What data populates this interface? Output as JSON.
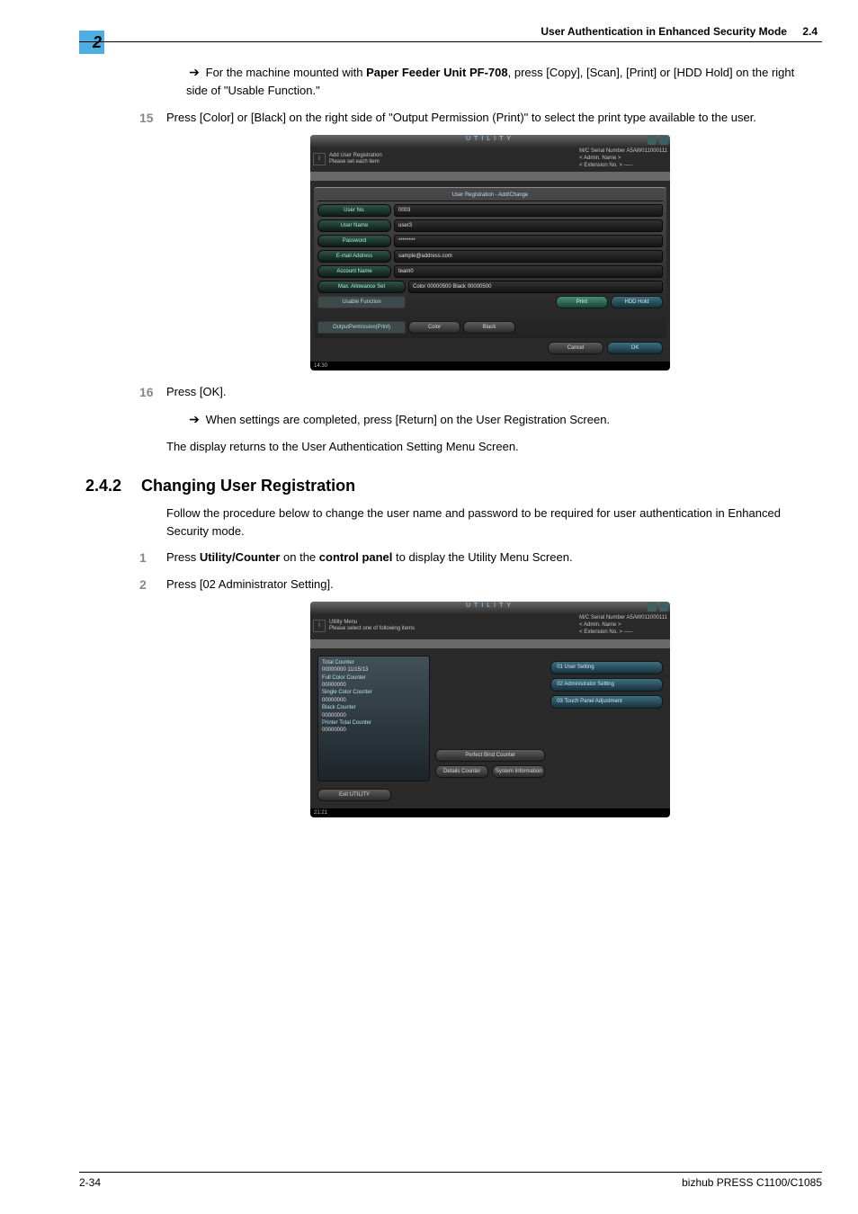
{
  "header": {
    "chapter_tab": "2",
    "running_title": "User Authentication in Enhanced Security Mode",
    "section_ref": "2.4"
  },
  "body": {
    "note14": {
      "text_a": "For the machine mounted with ",
      "bold": "Paper Feeder Unit PF-708",
      "text_b": ", press [Copy], [Scan], [Print] or [HDD Hold] on the right side of \"Usable Function.\""
    },
    "step15": {
      "num": "15",
      "text": "Press [Color] or [Black] on the right side of \"Output Permission (Print)\" to select the print type available to the user."
    },
    "shot1": {
      "titlebar": "UTILITY",
      "info_left_l1": "Add User Registration",
      "info_left_l2": "Please set each item",
      "info_right_l1": "M/C Serial Number  A5AW011000111",
      "info_right_l2": "< Admin. Name >",
      "info_right_l3": "< Extension No. >  -----",
      "panel_title": "User Registration - Add/Change",
      "rows": {
        "user_no": {
          "label": "User No.",
          "value": "0003"
        },
        "user_name": {
          "label": "User Name",
          "value": "user3"
        },
        "password": {
          "label": "Password",
          "value": "********"
        },
        "email": {
          "label": "E-mail Address",
          "value": "sample@address.com"
        },
        "account": {
          "label": "Account Name",
          "value": "team0"
        },
        "max_allow": {
          "label": "Max. Allowance Set",
          "value": "Color 00000500   Black 00000500"
        },
        "usable": {
          "label": "Usable Function",
          "btn_print": "Print",
          "btn_hold": "HDD Hold"
        },
        "output": {
          "label": "OutputPermission(Print)",
          "btn_color": "Color",
          "btn_black": "Black"
        }
      },
      "footer": {
        "cancel": "Cancel",
        "ok": "OK"
      },
      "status_time": "14:30"
    },
    "step16": {
      "num": "16",
      "line1": "Press [OK].",
      "sub_arrow": "When settings are completed, press [Return] on the User Registration Screen.",
      "line2": "The display returns to the User Authentication Setting Menu Screen."
    },
    "section": {
      "num": "2.4.2",
      "title": "Changing User Registration",
      "intro": "Follow the procedure below to change the user name and password to be required for user authentication in Enhanced Security mode."
    },
    "step1": {
      "num": "1",
      "pre": "Press ",
      "b1": "Utility/Counter",
      "mid": " on the ",
      "b2": "control panel",
      "post": " to display the Utility Menu Screen."
    },
    "step2": {
      "num": "2",
      "text": "Press [02 Administrator Setting]."
    },
    "shot2": {
      "titlebar": "UTILITY",
      "info_left_l1": "Utility Menu",
      "info_left_l2": "Please select one of following items",
      "info_right_l1": "M/C Serial Number  A5AW011000111",
      "info_right_l2": "< Admin. Name >",
      "info_right_l3": "< Extension No. >  -----",
      "counters": {
        "total_lbl": "Total Counter",
        "total_val": "00000000   11/15/13",
        "full_lbl": "Full Color Counter",
        "full_val": "00000000",
        "single_lbl": "Single Color Counter",
        "single_val": "00000000",
        "black_lbl": "Black Counter",
        "black_val": "00000000",
        "printer_lbl": "Printer Total Counter",
        "printer_val": "00000000"
      },
      "center_btns": {
        "pb": "Perfect Bind Counter",
        "details": "Details Counter",
        "sysinfo": "System Information"
      },
      "right_btns": {
        "m1": "01 User Setting",
        "m2": "02 Administrator Setting",
        "m3": "03 Touch Panel Adjustment"
      },
      "exit": "Exit UTILITY",
      "status_time": "21:21"
    }
  },
  "footer": {
    "pagenum": "2-34",
    "product": "bizhub PRESS C1100/C1085"
  }
}
